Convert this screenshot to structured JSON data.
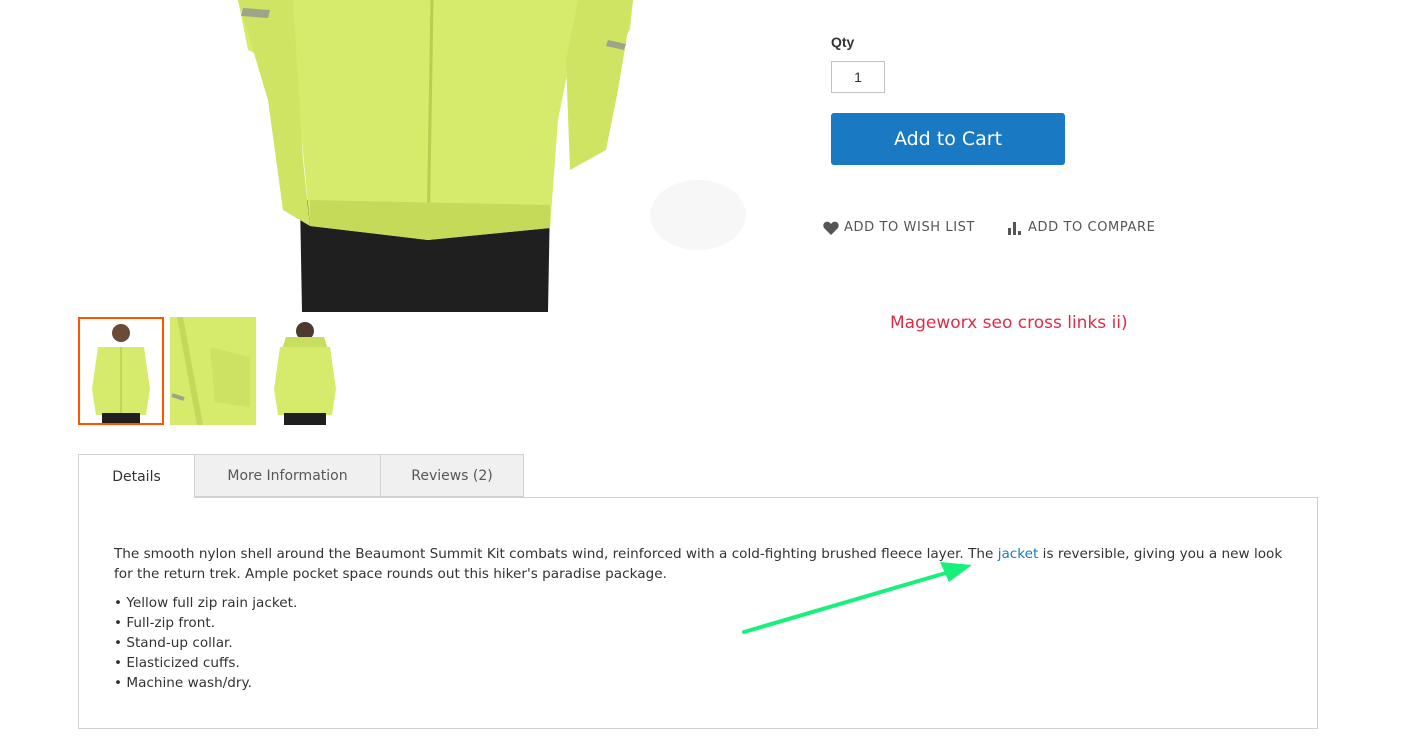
{
  "product": {
    "qty_label": "Qty",
    "qty_value": "1",
    "add_to_cart_label": "Add to Cart",
    "wish_list_label": "Add to Wish List",
    "compare_label": "Add to Compare"
  },
  "cross_links_title": "Mageworx seo cross links ii)",
  "tabs": [
    {
      "label": "Details",
      "active": true
    },
    {
      "label": "More Information",
      "active": false
    },
    {
      "label": "Reviews (2)",
      "active": false
    }
  ],
  "details": {
    "desc_before": "The smooth nylon shell around the Beaumont Summit Kit combats wind, reinforced with a cold-fighting brushed fleece layer. The ",
    "link_text": "jacket",
    "desc_after": " is reversible, giving you a new look for the return trek. Ample pocket space rounds out this hiker's paradise package.",
    "features": [
      "• Yellow full zip rain jacket.",
      "• Full-zip front.",
      "• Stand-up collar.",
      "• Elasticized cuffs.",
      "• Machine wash/dry."
    ]
  },
  "colors": {
    "accent": "#1979c3",
    "thumb_active_border": "#ff5501",
    "cross_title": "#e02b46",
    "annotation_arrow": "#17f07a",
    "jacket": "#d7ec6a"
  }
}
